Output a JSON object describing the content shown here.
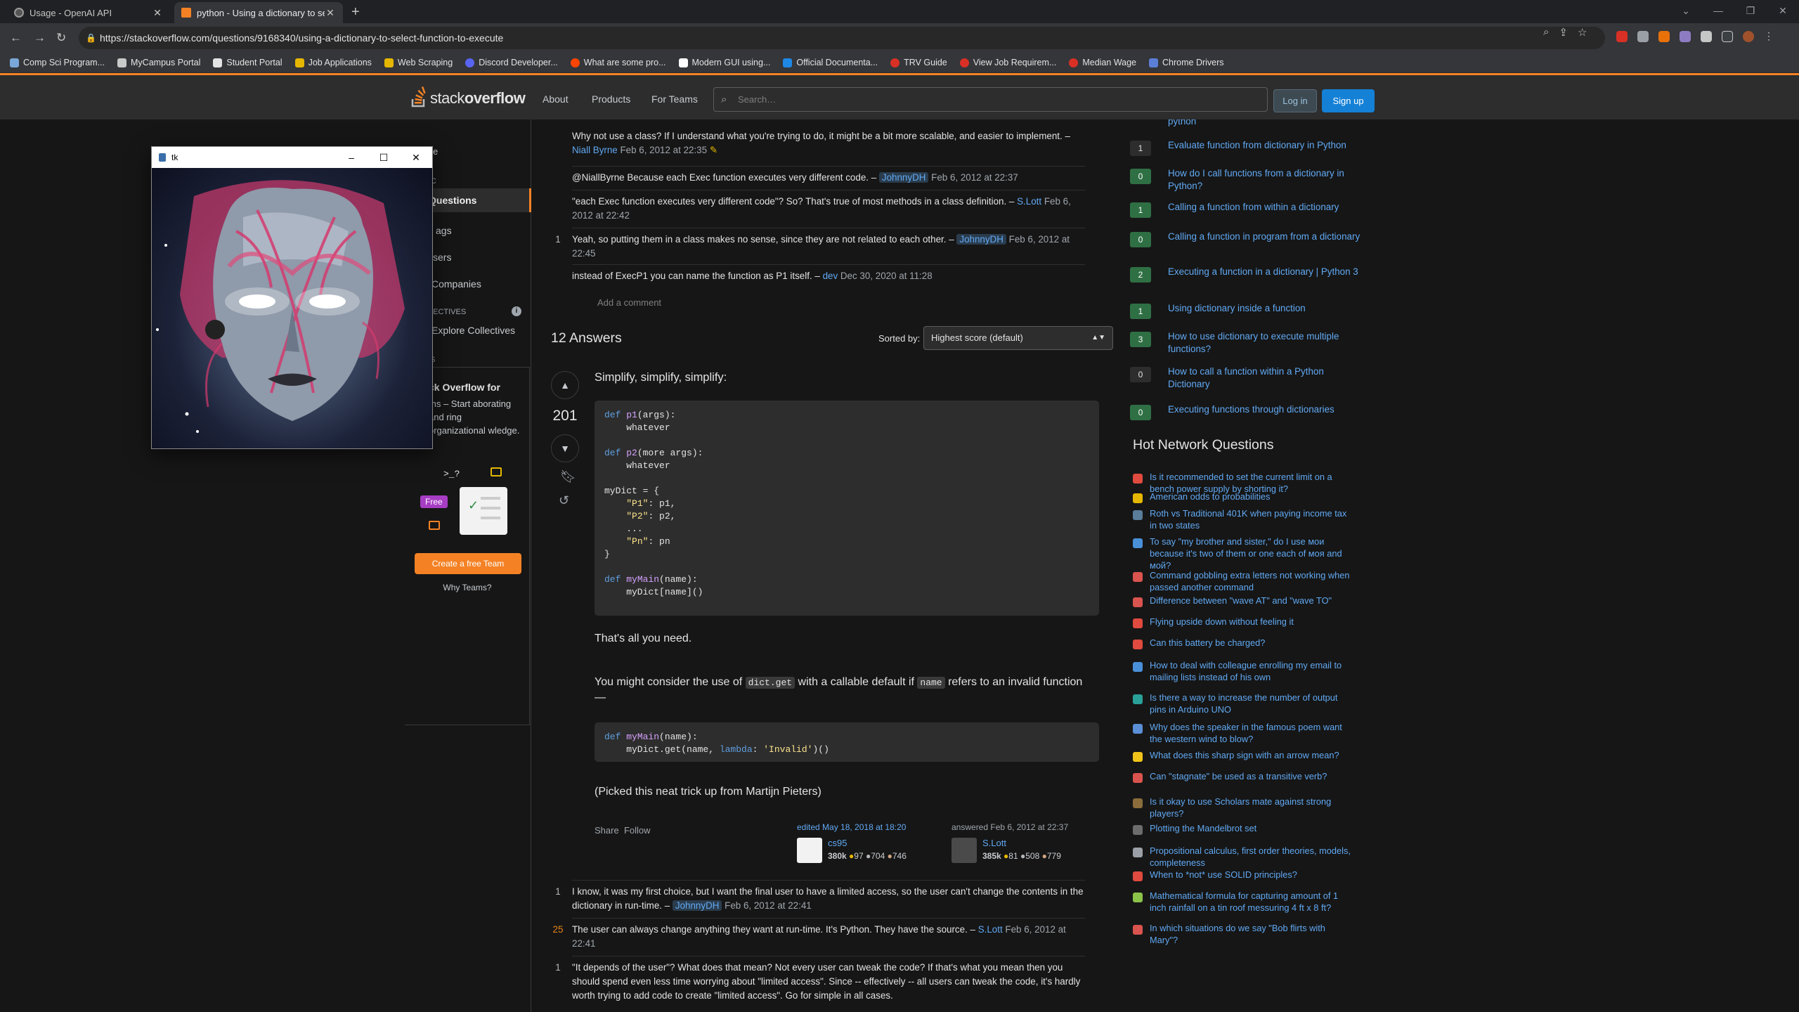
{
  "browser": {
    "tabs": [
      {
        "title": "Usage - OpenAI API",
        "active": false
      },
      {
        "title": "python - Using a dictionary to se",
        "active": true
      }
    ],
    "url": "https://stackoverflow.com/questions/9168340/using-a-dictionary-to-select-function-to-execute",
    "bookmarks": [
      "Comp Sci Program...",
      "MyCampus Portal",
      "Student Portal",
      "Job Applications",
      "Web Scraping",
      "Discord Developer...",
      "What are some pro...",
      "Modern GUI using...",
      "Official Documenta...",
      "TRV Guide",
      "View Job Requirem...",
      "Median Wage",
      "Chrome Drivers"
    ]
  },
  "so_header": {
    "logo_light": "stack",
    "logo_bold": "overflow",
    "nav": [
      "About",
      "Products",
      "For Teams"
    ],
    "search_placeholder": "Search…",
    "login": "Log in",
    "signup": "Sign up"
  },
  "left_nav": {
    "home": "e",
    "public": "IC",
    "questions": "Questions",
    "tags": "ags",
    "users": "sers",
    "companies": "Companies",
    "collectives": "LECTIVES",
    "explore": "Explore Collectives",
    "teams_label": "S",
    "teams_title": "ck Overflow for",
    "teams_desc": "ms – Start aborating and ring organizational wledge.",
    "free": "Free",
    "create_team": "Create a free Team",
    "why_teams": "Why Teams?"
  },
  "question_comments": [
    {
      "score": "",
      "text": "Why not use a class? If I understand what you're trying to do, it might be a bit more scalable, and easier to implement. – ",
      "user": "Niall Byrne",
      "date": "Feb 6, 2012 at 22:35",
      "highlight": false
    },
    {
      "score": "",
      "text": "@NiallByrne Because each Exec function executes very different code. – ",
      "user": "JohnnyDH",
      "date": "Feb 6, 2012 at 22:37",
      "highlight": true
    },
    {
      "score": "",
      "text": "\"each Exec function executes very different code\"? So? That's true of most methods in a class definition. – ",
      "user": "S.Lott",
      "date": "Feb 6, 2012 at 22:42",
      "highlight": false
    },
    {
      "score": "1",
      "text": "Yeah, so putting them in a class makes no sense, since they are not related to each other. – ",
      "user": "JohnnyDH",
      "date": "Feb 6, 2012 at 22:45",
      "highlight": true
    },
    {
      "score": "",
      "text": "instead of ExecP1 you can name the function as P1 itself. – ",
      "user": "dev",
      "date": "Dec 30, 2020 at 11:28",
      "highlight": false
    }
  ],
  "add_comment": "Add a comment",
  "answers": {
    "count_label": "12 Answers",
    "sort_label": "Sorted by:",
    "sort_value": "Highest score (default)"
  },
  "answer": {
    "votes": "201",
    "intro": "Simplify, simplify, simplify:",
    "all_you_need": "That's all you need.",
    "consider_pre": "You might consider the use of ",
    "consider_code1": "dict.get",
    "consider_mid": " with a callable default if ",
    "consider_code2": "name",
    "consider_post": " refers to an invalid function—",
    "picked": "(Picked this neat trick up from Martijn Pieters)",
    "share": "Share",
    "follow": "Follow",
    "edited": "edited May 18, 2018 at 18:20",
    "editor": "cs95",
    "editor_rep": "380k",
    "editor_gold": "97",
    "editor_silver": "704",
    "editor_bronze": "746",
    "answered": "answered Feb 6, 2012 at 22:37",
    "author": "S.Lott",
    "author_rep": "385k",
    "author_gold": "81",
    "author_silver": "508",
    "author_bronze": "779"
  },
  "answer_comments": [
    {
      "score": "1",
      "text": "I know, it was my first choice, but I want the final user to have a limited access, so the user can't change the contents in the dictionary in run-time. – ",
      "user": "JohnnyDH",
      "date": "Feb 6, 2012 at 22:41",
      "highlight": true
    },
    {
      "score": "25",
      "text": "The user can always change anything they want at run-time. It's Python. They have the source. – ",
      "user": "S.Lott",
      "date": "Feb 6, 2012 at 22:41",
      "highlight": false
    },
    {
      "score": "1",
      "text": "\"It depends of the user\"? What does that mean? Not every user can tweak the code? If that's what you mean then you should spend even less time worrying about \"limited access\". Since -- effectively -- all users can tweak the code, it's hardly worth trying to add code to create \"limited access\". Go for simple in all cases.",
      "user": "",
      "date": "",
      "highlight": false
    }
  ],
  "related": [
    {
      "score": "",
      "title": "python",
      "answered": false
    },
    {
      "score": "1",
      "title": "Evaluate function from dictionary in Python",
      "answered": false
    },
    {
      "score": "0",
      "title": "How do I call functions from a dictionary in Python?",
      "answered": true
    },
    {
      "score": "1",
      "title": "Calling a function from within a dictionary",
      "answered": true
    },
    {
      "score": "0",
      "title": "Calling a function in program from a dictionary",
      "answered": true
    },
    {
      "score": "2",
      "title": "Executing a function in a dictionary | Python 3",
      "answered": true
    },
    {
      "score": "1",
      "title": "Using dictionary inside a function",
      "answered": true
    },
    {
      "score": "3",
      "title": "How to use dictionary to execute multiple functions?",
      "answered": true
    },
    {
      "score": "0",
      "title": "How to call a function within a Python Dictionary",
      "answered": false
    },
    {
      "score": "0",
      "title": "Executing functions through dictionaries",
      "answered": true
    }
  ],
  "hot_network": {
    "title": "Hot Network Questions",
    "items": [
      {
        "title": "Is it recommended to set the current limit on a bench power supply by shorting it?",
        "color": "#e04a3f"
      },
      {
        "title": "American odds to probabilities",
        "color": "#e5b700"
      },
      {
        "title": "Roth vs Traditional 401K when paying income tax in two states",
        "color": "#5a7d9a"
      },
      {
        "title": "To say \"my brother and sister,\" do I use мои because it's two of them or one each of моя and мой?",
        "color": "#4a90d9"
      },
      {
        "title": "Command gobbling extra letters not working when passed another command",
        "color": "#d9534f"
      },
      {
        "title": "Difference between \"wave AT\" and \"wave TO\"",
        "color": "#d9534f"
      },
      {
        "title": "Flying upside down without feeling it",
        "color": "#e04a3f"
      },
      {
        "title": "Can this battery be charged?",
        "color": "#e04a3f"
      },
      {
        "title": "How to deal with colleague enrolling my email to mailing lists instead of his own",
        "color": "#4a90d9"
      },
      {
        "title": "Is there a way to increase the number of output pins in Arduino UNO",
        "color": "#2aa198"
      },
      {
        "title": "Why does the speaker in the famous poem want the western wind to blow?",
        "color": "#5b8fd6"
      },
      {
        "title": "What does this sharp sign with an arrow mean?",
        "color": "#f0c419"
      },
      {
        "title": "Can \"stagnate\" be used as a transitive verb?",
        "color": "#d9534f"
      },
      {
        "title": "Is it okay to use Scholars mate against strong players?",
        "color": "#8a6d3b"
      },
      {
        "title": "Plotting the Mandelbrot set",
        "color": "#6c6c6c"
      },
      {
        "title": "Propositional calculus, first order theories, models, completeness",
        "color": "#9aa0a6"
      },
      {
        "title": "When to *not* use SOLID principles?",
        "color": "#e04a3f"
      },
      {
        "title": "Mathematical formula for capturing amount of 1 inch rainfall on a tin roof messuring 4 ft x 8 ft?",
        "color": "#8bc34a"
      },
      {
        "title": "In which situations do we say \"Bob flirts with Mary\"?",
        "color": "#d9534f"
      }
    ]
  },
  "tk_window": {
    "title": "tk",
    "min": "–",
    "max": "☐",
    "close": "✕"
  },
  "colors": {
    "accent": "#f48225",
    "link": "#61a9f3",
    "signup": "#1481d6",
    "answered": "#2f6f44"
  }
}
